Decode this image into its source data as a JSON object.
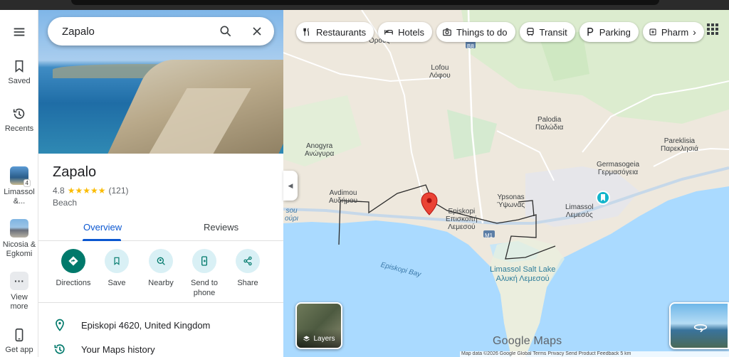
{
  "rail": {
    "menu_icon": "menu-icon",
    "saved_label": "Saved",
    "recents_label": "Recents",
    "recent1_label": "Limassol &...",
    "recent1_badge": "4",
    "recent2_label": "Nicosia & Egkomi",
    "view_more_label": "View more",
    "get_app_label": "Get app"
  },
  "search": {
    "value": "Zapalo"
  },
  "place": {
    "title": "Zapalo",
    "rating": "4.8",
    "stars": "★★★★★",
    "reviews_count": "(121)",
    "category": "Beach"
  },
  "tabs": [
    {
      "label": "Overview",
      "active": true
    },
    {
      "label": "Reviews",
      "active": false
    }
  ],
  "actions": [
    {
      "label": "Directions",
      "icon": "directions-icon"
    },
    {
      "label": "Save",
      "icon": "bookmark-icon"
    },
    {
      "label": "Nearby",
      "icon": "nearby-icon"
    },
    {
      "label": "Send to phone",
      "icon": "send-to-phone-icon"
    },
    {
      "label": "Share",
      "icon": "share-icon"
    }
  ],
  "info": {
    "address": "Episkopi 4620, United Kingdom",
    "history": "Your Maps history"
  },
  "chips": [
    {
      "label": "Restaurants",
      "icon": "fork-knife-icon"
    },
    {
      "label": "Hotels",
      "icon": "bed-icon"
    },
    {
      "label": "Things to do",
      "icon": "camera-icon"
    },
    {
      "label": "Transit",
      "icon": "bus-icon"
    },
    {
      "label": "Parking",
      "icon": "parking-icon"
    },
    {
      "label": "Pharm",
      "icon": "pharmacy-icon"
    }
  ],
  "map": {
    "labels": {
      "orous": "Όρους",
      "lofou": "Lofou",
      "lofou_gr": "Λόφου",
      "palodia": "Palodia",
      "palodia_gr": "Παλώδια",
      "pareklisia": "Pareklisia",
      "pareklisia_gr": "Παρεκλησιά",
      "anogyra": "Anogyra",
      "anogyra_gr": "Ανώγυρα",
      "germasogeia": "Germasogeia",
      "germasogeia_gr": "Γερμασόγεια",
      "avdimou": "Avdimou",
      "avdimou_gr": "Αυδήμου",
      "ypsonas": "Ypsonas",
      "ypsonas_gr": "Ύψωνας",
      "limassol": "Limassol",
      "limassol_gr": "Λεμεσός",
      "episkopi": "Episkopi",
      "episkopi_gr": "Επισκοπή",
      "episkopi_gr2": "Λεμεσού",
      "sou": "sou",
      "ouri": "ούρι",
      "episkopi_bay": "Episkopi Bay",
      "salt_lake": "Limassol Salt Lake",
      "salt_lake_gr": "Αλυκή Λεμεσού",
      "b8": "B8",
      "m1": "M1"
    },
    "layers_label": "Layers",
    "logo": "Google Maps",
    "attribution": "Map data ©2026 Google    Global    Terms    Privacy    Send Product Feedback    5 km",
    "colors": {
      "water": "#aadaff",
      "land": "#eee8dd",
      "green": "#cfe8c2",
      "pin": "#ea4335",
      "road": "#ffffff",
      "highway": "#c6d8e9"
    }
  }
}
